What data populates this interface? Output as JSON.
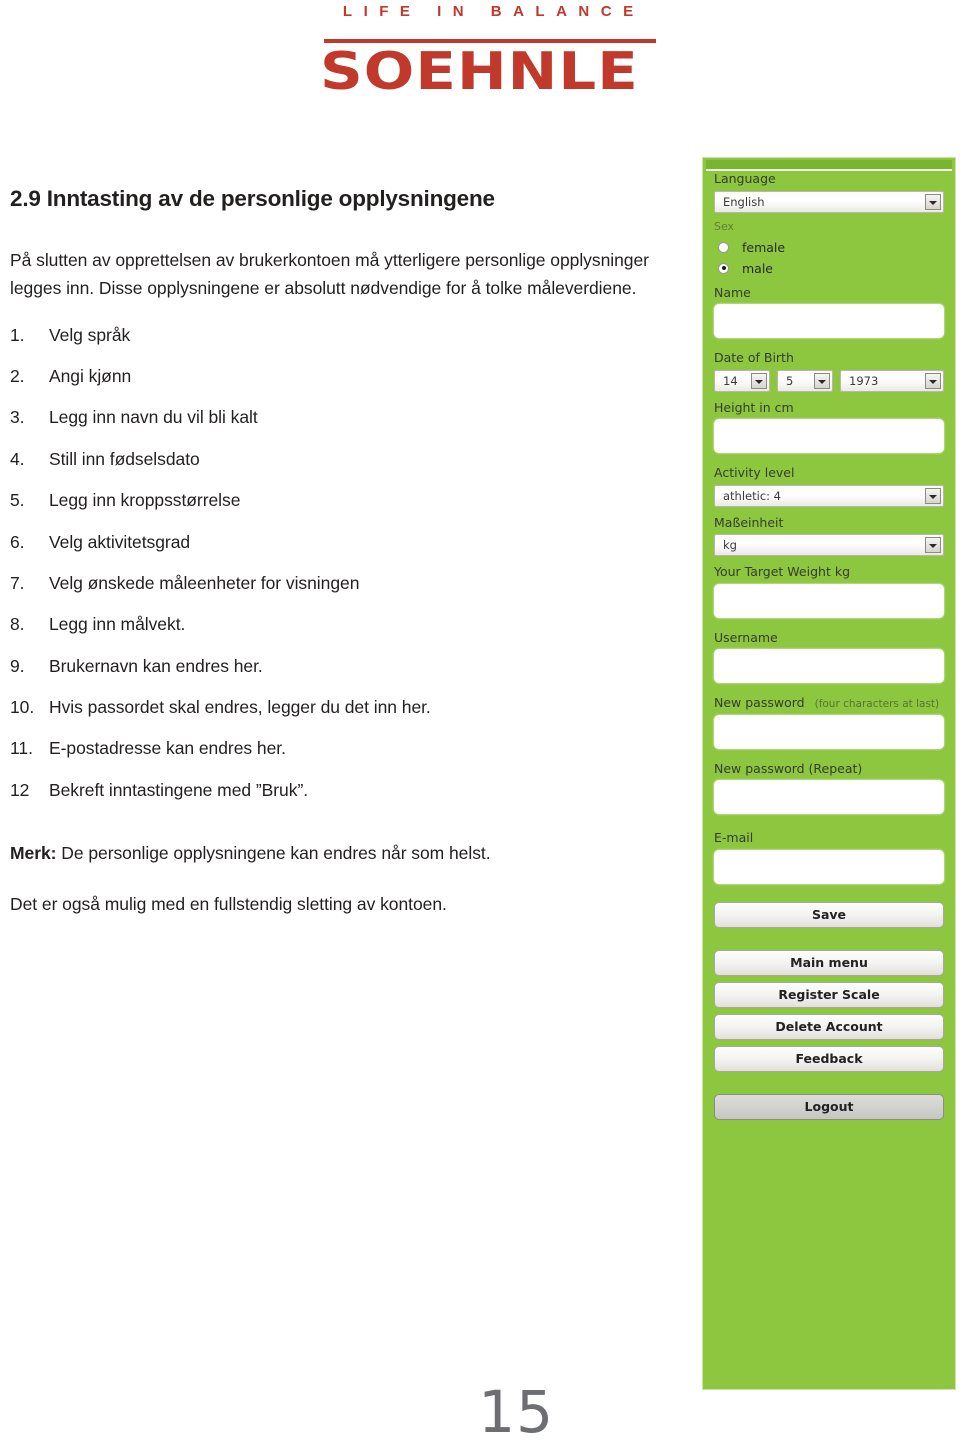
{
  "brand": {
    "tagline": "LIFE IN BALANCE",
    "wordmark": "SOEHNLE",
    "color": "#c0392b"
  },
  "document": {
    "title": "2.9 Inntasting av de personlige opplysningene",
    "intro": "På slutten av opprettelsen av brukerkontoen må ytterligere personlige opplysninger legges inn. Disse opplysningene er absolutt nødvendige for å tolke måleverdiene.",
    "steps": [
      {
        "num": "1.",
        "text": "Velg språk"
      },
      {
        "num": "2.",
        "text": "Angi kjønn"
      },
      {
        "num": "3.",
        "text": "Legg inn navn du vil bli kalt"
      },
      {
        "num": "4.",
        "text": "Still inn fødselsdato"
      },
      {
        "num": "5.",
        "text": "Legg inn kroppsstørrelse"
      },
      {
        "num": "6.",
        "text": "Velg aktivitetsgrad"
      },
      {
        "num": "7.",
        "text": "Velg ønskede måleenheter for visningen"
      },
      {
        "num": "8.",
        "text": "Legg inn målvekt."
      },
      {
        "num": "9.",
        "text": "Brukernavn kan endres her."
      },
      {
        "num": "10.",
        "text": "Hvis passordet skal endres, legger du det inn her."
      },
      {
        "num": "11.",
        "text": "E-postadresse kan endres her."
      },
      {
        "num": "12",
        "text": "Bekreft inntastingene med ”Bruk”."
      }
    ],
    "note_label": "Merk:",
    "note_1": "De personlige opplysningene kan endres når som helst.",
    "note_2": "Det er også mulig med en fullstendig sletting av kontoen.",
    "page_number": "15"
  },
  "app": {
    "accent_color": "#8dc63f",
    "language": {
      "label": "Language",
      "value": "English"
    },
    "sex": {
      "label": "Sex",
      "options": [
        {
          "label": "female",
          "selected": false
        },
        {
          "label": "male",
          "selected": true
        }
      ]
    },
    "name": {
      "label": "Name",
      "value": ""
    },
    "date_of_birth": {
      "label": "Date of Birth",
      "day": "14",
      "month": "5",
      "year": "1973"
    },
    "height": {
      "label": "Height in cm",
      "value": ""
    },
    "activity_level": {
      "label": "Activity level",
      "value": "athletic: 4"
    },
    "unit": {
      "label": "Maßeinheit",
      "value": "kg"
    },
    "target_weight": {
      "label": "Your Target Weight kg",
      "value": ""
    },
    "username": {
      "label": "Username",
      "value": ""
    },
    "new_password": {
      "label": "New password",
      "hint": "(four characters at last)",
      "value": ""
    },
    "new_password_repeat": {
      "label": "New password (Repeat)",
      "value": ""
    },
    "email": {
      "label": "E-mail",
      "value": ""
    },
    "buttons": {
      "save": "Save",
      "main_menu": "Main menu",
      "register_scale": "Register Scale",
      "delete_account": "Delete Account",
      "feedback": "Feedback",
      "logout": "Logout"
    }
  }
}
